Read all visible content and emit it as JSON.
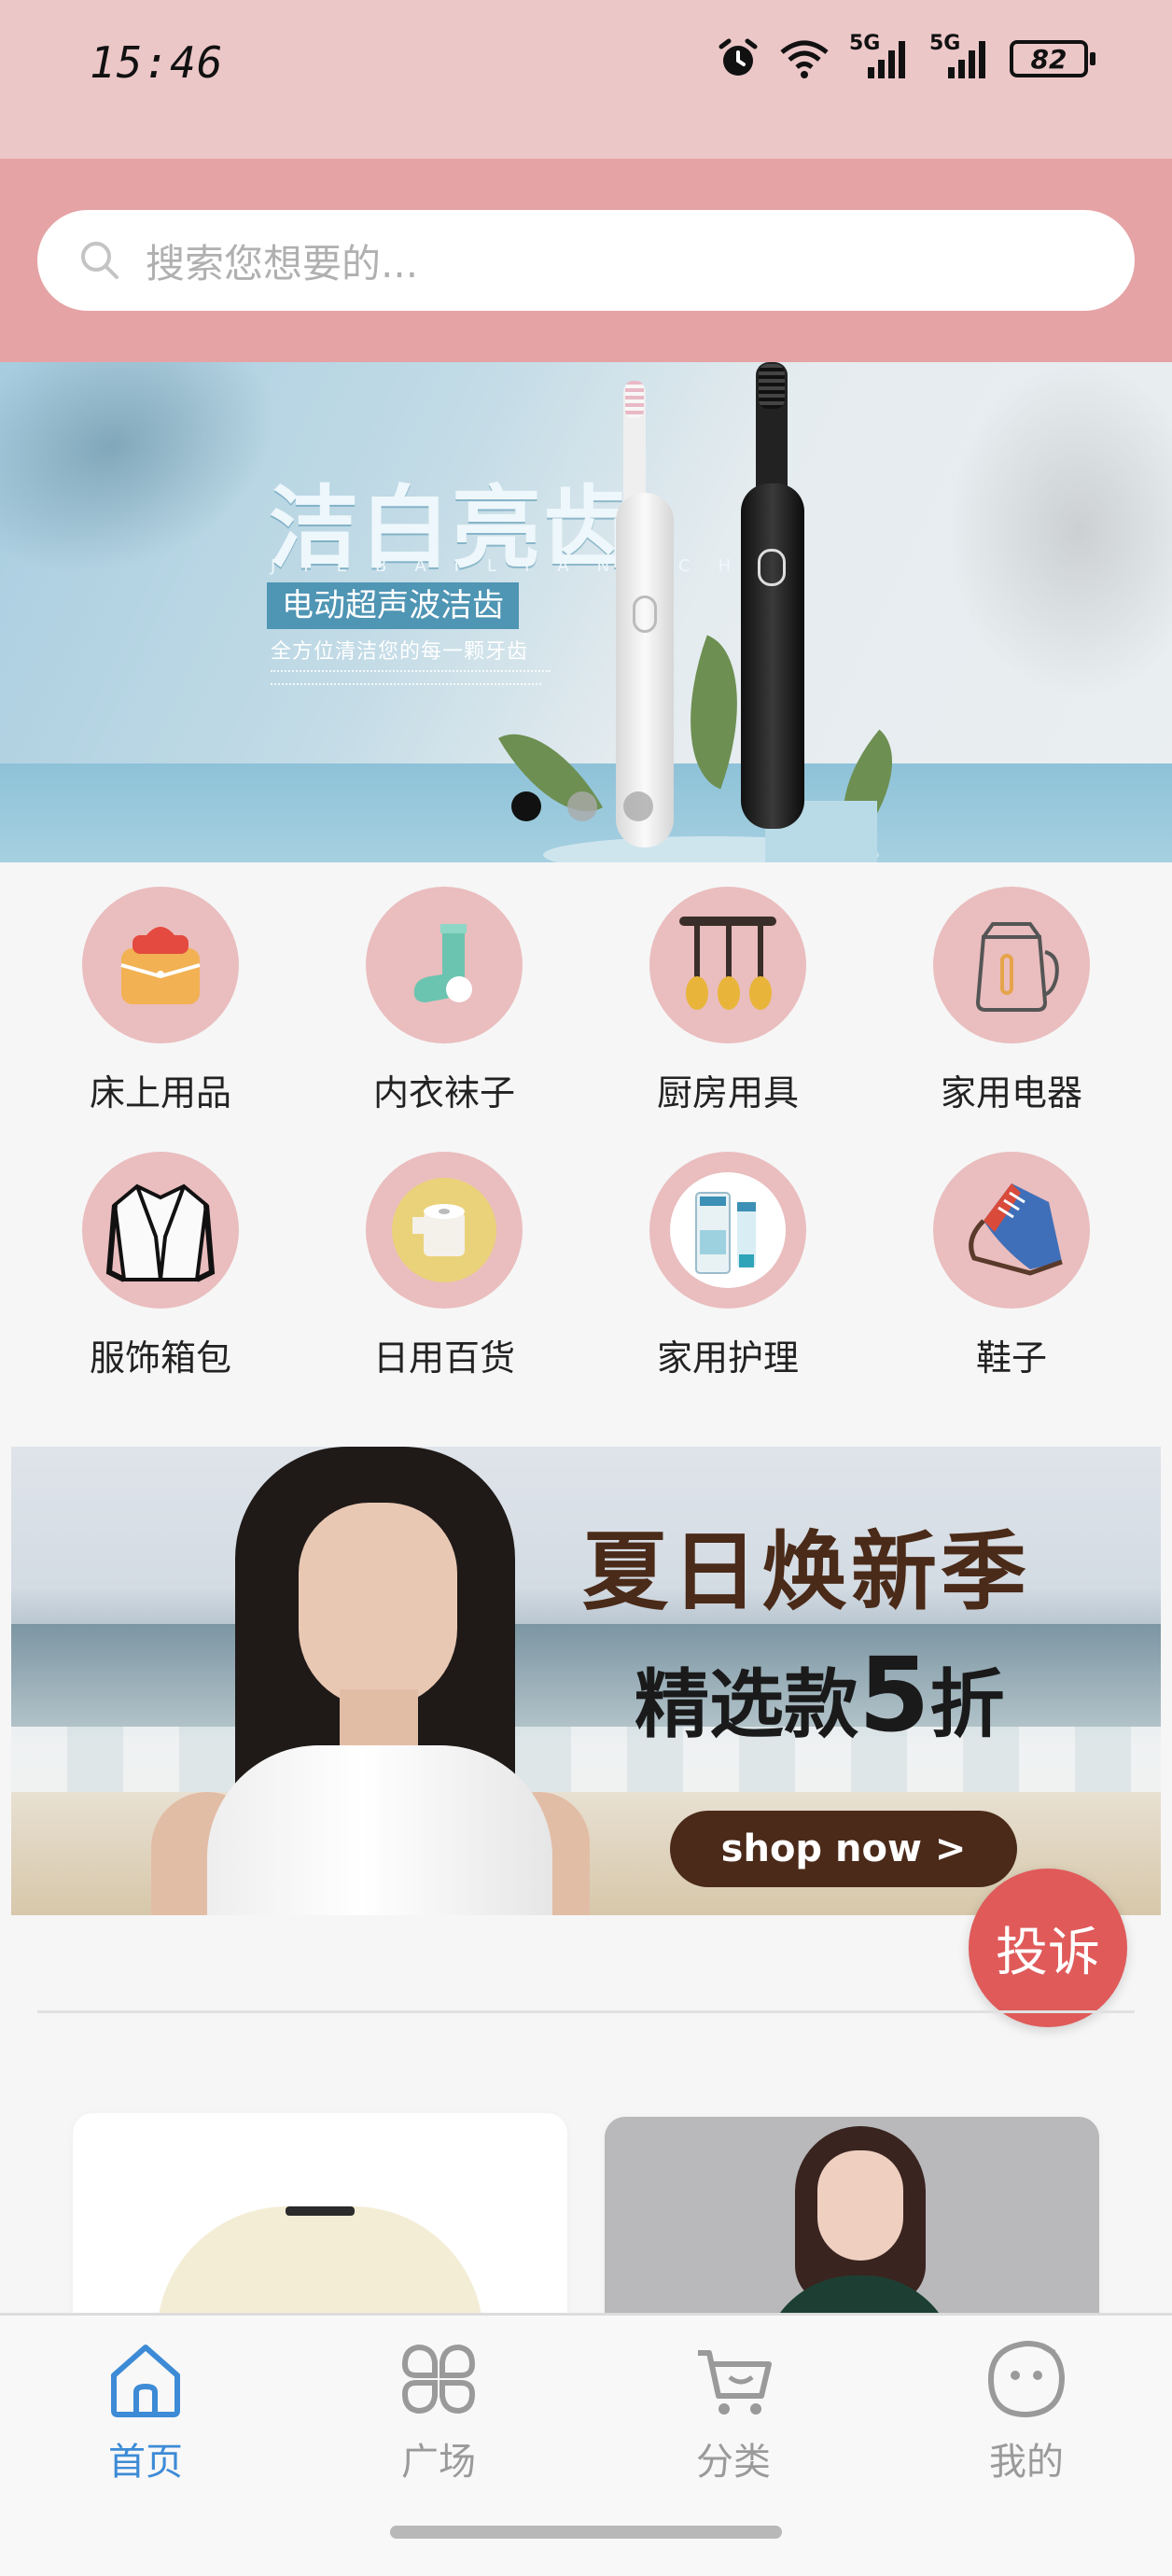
{
  "status_bar": {
    "time": "15:46",
    "battery": "82",
    "network_1": "5G",
    "network_2": "5G"
  },
  "search": {
    "placeholder": "搜索您想要的..."
  },
  "hero_banner": {
    "title": "洁白亮齿",
    "pinyin": "JIEBAILIANGCHI",
    "tag": "电动超声波洁齿",
    "subtitle": "全方位清洁您的每一颗牙齿",
    "slide_count": 3,
    "active_slide": 1
  },
  "categories": [
    {
      "label": "床上用品",
      "icon": "bedding-icon"
    },
    {
      "label": "内衣袜子",
      "icon": "sock-icon"
    },
    {
      "label": "厨房用具",
      "icon": "kitchen-utensils-icon"
    },
    {
      "label": "家用电器",
      "icon": "kettle-icon"
    },
    {
      "label": "服饰箱包",
      "icon": "jacket-icon"
    },
    {
      "label": "日用百货",
      "icon": "tissue-roll-icon"
    },
    {
      "label": "家用护理",
      "icon": "toothpaste-icon"
    },
    {
      "label": "鞋子",
      "icon": "shoe-icon"
    }
  ],
  "promo_banner": {
    "title": "夏日焕新季",
    "subtitle_prefix": "精选款",
    "subtitle_number": "5",
    "subtitle_suffix": "折",
    "button": "shop now >"
  },
  "complaint_button": "投诉",
  "bottom_nav": [
    {
      "label": "首页",
      "icon": "home-icon",
      "active": true
    },
    {
      "label": "广场",
      "icon": "plaza-icon",
      "active": false
    },
    {
      "label": "分类",
      "icon": "cart-icon",
      "active": false
    },
    {
      "label": "我的",
      "icon": "profile-icon",
      "active": false
    }
  ],
  "colors": {
    "status_bg": "#ecc7c8",
    "search_bg": "#e5a3a5",
    "category_circle": "#eabdbe",
    "nav_active": "#3d8bd6",
    "nav_inactive": "#9a9a9a",
    "complaint": "#e05a5a",
    "shop_button": "#4b2a19"
  }
}
